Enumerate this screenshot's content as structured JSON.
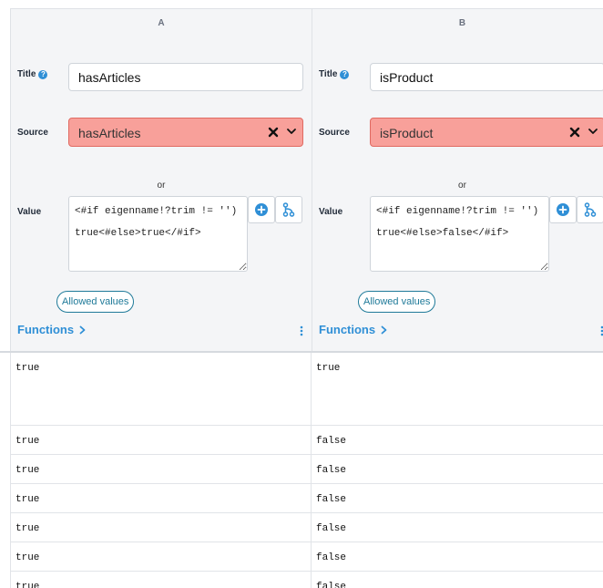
{
  "columns": [
    {
      "letter": "A",
      "title_label": "Title",
      "title_value": "hasArticles",
      "source_label": "Source",
      "source_value": "hasArticles",
      "or_text": "or",
      "value_label": "Value",
      "value_text": "<#if eigenname!?trim != '')true<#else>true</#if>",
      "allowed_values_label": "Allowed values",
      "functions_label": "Functions"
    },
    {
      "letter": "B",
      "title_label": "Title",
      "title_value": "isProduct",
      "source_label": "Source",
      "source_value": "isProduct",
      "or_text": "or",
      "value_label": "Value",
      "value_text": "<#if eigenname!?trim != '')true<#else>false</#if>",
      "allowed_values_label": "Allowed values",
      "functions_label": "Functions"
    }
  ],
  "results": [
    [
      "true",
      "true"
    ],
    [
      "true",
      "false"
    ],
    [
      "true",
      "false"
    ],
    [
      "true",
      "false"
    ],
    [
      "true",
      "false"
    ],
    [
      "true",
      "false"
    ],
    [
      "true",
      "false"
    ]
  ],
  "colors": {
    "accent": "#2f8fd6",
    "error_fill": "#f8a09a",
    "error_border": "#e06a62",
    "pill": "#1f7a99"
  },
  "icons": {
    "help": "help-circle-icon",
    "clear": "x-icon",
    "dropdown": "chevron-down-icon",
    "add": "plus-circle-icon",
    "branch": "branch-icon",
    "functions": "chevron-right-icon",
    "menu": "kebab-menu-icon"
  }
}
